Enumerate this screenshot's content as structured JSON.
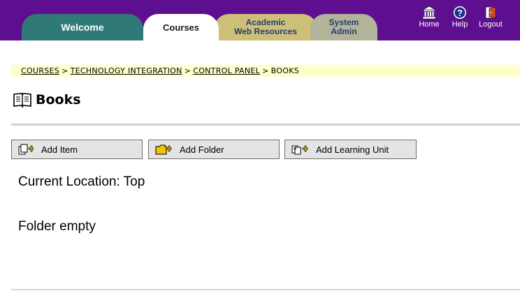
{
  "tabs": [
    {
      "label": "Welcome",
      "lines": [
        "Welcome"
      ]
    },
    {
      "label": "Courses",
      "lines": [
        "Courses"
      ]
    },
    {
      "label": "Academic Web Resources",
      "lines": [
        "Academic",
        "Web Resources"
      ]
    },
    {
      "label": "System Admin",
      "lines": [
        "System",
        "Admin"
      ]
    }
  ],
  "utility": [
    {
      "label": "Home",
      "icon": "home-icon"
    },
    {
      "label": "Help",
      "icon": "help-icon"
    },
    {
      "label": "Logout",
      "icon": "logout-icon"
    }
  ],
  "breadcrumb": {
    "items": [
      "COURSES",
      "TECHNOLOGY INTEGRATION",
      "CONTROL PANEL",
      "BOOKS"
    ],
    "separator": ">"
  },
  "page": {
    "title": "Books",
    "title_icon": "book-icon",
    "current_location": "Current Location: Top",
    "status": "Folder empty"
  },
  "actions": [
    {
      "label": "Add Item",
      "icon": "add-item-icon"
    },
    {
      "label": "Add Folder",
      "icon": "add-folder-icon"
    },
    {
      "label": "Add Learning Unit",
      "icon": "add-learning-unit-icon"
    }
  ],
  "colors": {
    "header": "#5e0f8f",
    "tab_welcome": "#2f7a78",
    "tab_academic": "#cdbf78",
    "tab_system": "#b2b39a",
    "breadcrumb_bg": "#ffffcc"
  }
}
